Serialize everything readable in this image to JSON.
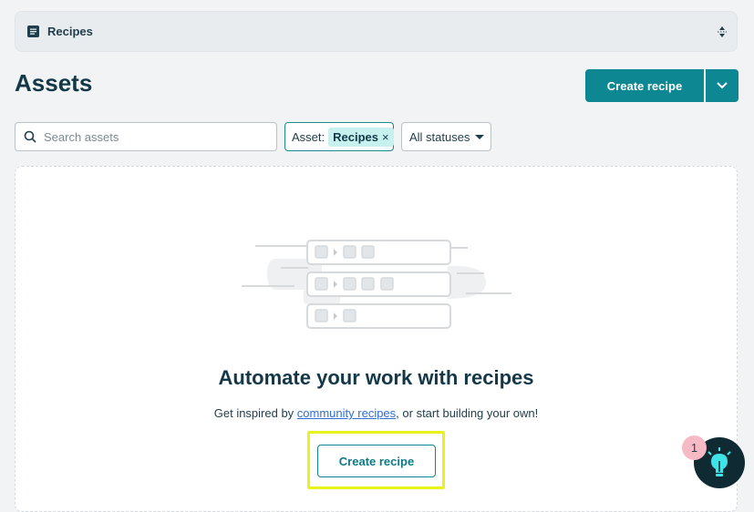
{
  "breadcrumb": {
    "title": "Recipes",
    "icon": "document-icon"
  },
  "page": {
    "title": "Assets"
  },
  "header_actions": {
    "create_label": "Create recipe",
    "dropdown_icon": "chevron-down-icon"
  },
  "filters": {
    "search_placeholder": "Search assets",
    "asset_label": "Asset:",
    "asset_chip": "Recipes",
    "asset_chip_remove": "×",
    "status_label": "All statuses"
  },
  "empty_state": {
    "title": "Automate your work with recipes",
    "subtitle_prefix": "Get inspired by ",
    "subtitle_link": "community recipes",
    "subtitle_suffix": ", or start building your own!",
    "button_label": "Create recipe"
  },
  "help": {
    "badge_count": "1",
    "icon": "lightbulb-icon"
  },
  "colors": {
    "primary": "#0d8791",
    "highlight": "#eaf21e",
    "badge": "#f7b9c4",
    "chip": "#c6f1ee"
  }
}
